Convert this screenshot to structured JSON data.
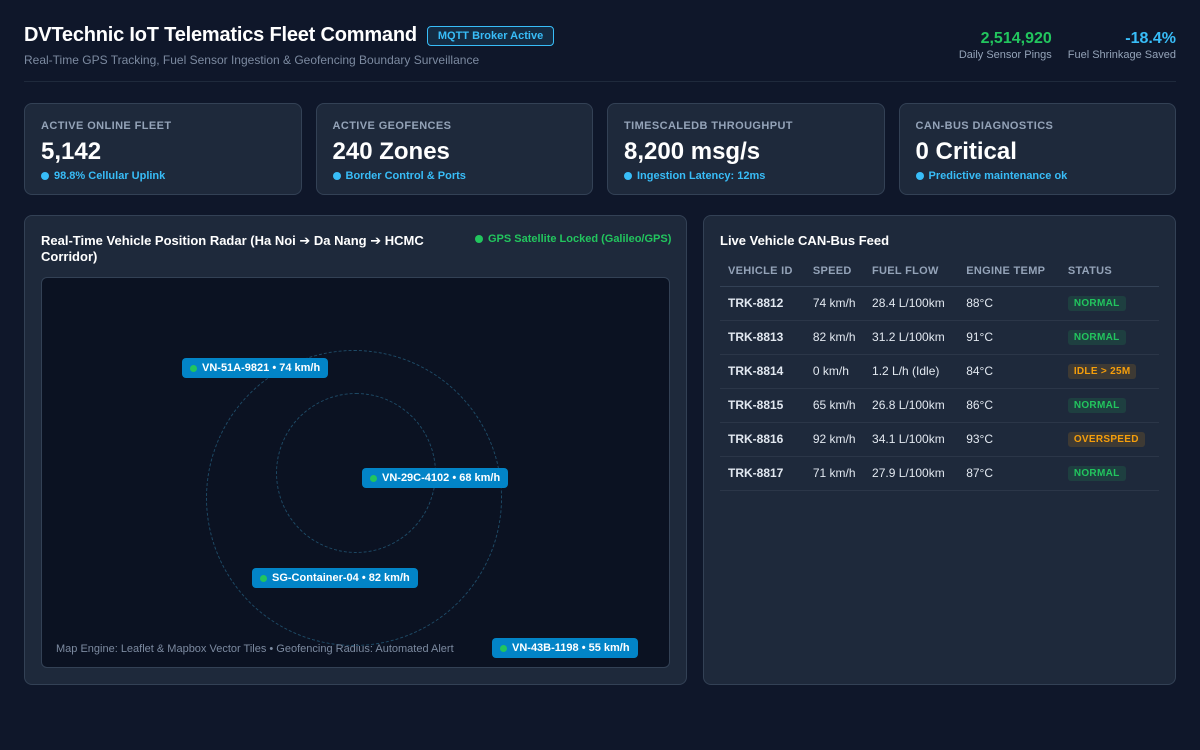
{
  "header": {
    "title": "DVTechnic IoT Telematics Fleet Command",
    "badge": "MQTT Broker Active",
    "subtitle": "Real-Time GPS Tracking, Fuel Sensor Ingestion & Geofencing Boundary Surveillance",
    "stats": [
      {
        "value": "2,514,920",
        "label": "Daily Sensor Pings",
        "color": "#22c55e"
      },
      {
        "value": "-18.4%",
        "label": "Fuel Shrinkage Saved",
        "color": "#38bdf8"
      }
    ]
  },
  "kpis": [
    {
      "label": "ACTIVE ONLINE FLEET",
      "value": "5,142",
      "sub": "98.8% Cellular Uplink"
    },
    {
      "label": "ACTIVE GEOFENCES",
      "value": "240 Zones",
      "sub": "Border Control & Ports"
    },
    {
      "label": "TIMESCALEDB THROUGHPUT",
      "value": "8,200 msg/s",
      "sub": "Ingestion Latency: 12ms"
    },
    {
      "label": "CAN-BUS DIAGNOSTICS",
      "value": "0 Critical",
      "sub": "Predictive maintenance ok"
    }
  ],
  "radar": {
    "title": "Real-Time Vehicle Position Radar (Ha Noi ➔ Da Nang ➔ HCMC Corridor)",
    "gps_status": "GPS Satellite Locked (Galileo/GPS)",
    "vehicles": [
      {
        "label": "VN-51A-9821 • 74 km/h"
      },
      {
        "label": "VN-29C-4102 • 68 km/h"
      },
      {
        "label": "SG-Container-04 • 82 km/h"
      },
      {
        "label": "VN-43B-1198 • 55 km/h"
      }
    ],
    "footer": "Map Engine: Leaflet & Mapbox Vector Tiles • Geofencing Radius: Automated Alert"
  },
  "feed": {
    "title": "Live Vehicle CAN-Bus Feed",
    "columns": [
      "VEHICLE ID",
      "SPEED",
      "FUEL FLOW",
      "ENGINE TEMP",
      "STATUS"
    ],
    "rows": [
      {
        "id": "TRK-8812",
        "speed": "74 km/h",
        "fuel": "28.4 L/100km",
        "temp": "88°C",
        "status": "NORMAL",
        "level": "normal"
      },
      {
        "id": "TRK-8813",
        "speed": "82 km/h",
        "fuel": "31.2 L/100km",
        "temp": "91°C",
        "status": "NORMAL",
        "level": "normal"
      },
      {
        "id": "TRK-8814",
        "speed": "0 km/h",
        "fuel": "1.2 L/h (Idle)",
        "temp": "84°C",
        "status": "IDLE > 25M",
        "level": "warn"
      },
      {
        "id": "TRK-8815",
        "speed": "65 km/h",
        "fuel": "26.8 L/100km",
        "temp": "86°C",
        "status": "NORMAL",
        "level": "normal"
      },
      {
        "id": "TRK-8816",
        "speed": "92 km/h",
        "fuel": "34.1 L/100km",
        "temp": "93°C",
        "status": "OVERSPEED",
        "level": "warn"
      },
      {
        "id": "TRK-8817",
        "speed": "71 km/h",
        "fuel": "27.9 L/100km",
        "temp": "87°C",
        "status": "NORMAL",
        "level": "normal"
      }
    ]
  }
}
